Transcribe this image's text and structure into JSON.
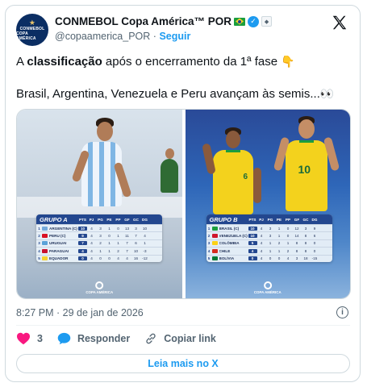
{
  "account": {
    "avatar_line1": "CONMEBOL",
    "avatar_line2": "COPA AMÉRICA",
    "display_name": "CONMEBOL Copa América™ POR",
    "handle": "@copaamerica_POR",
    "separator": "·",
    "follow_label": "Seguir"
  },
  "tweet": {
    "text_part1": "A ",
    "text_bold": "classificação",
    "text_part2": " após o encerramento da 1ª fase ",
    "emoji1": "👇",
    "line2": "Brasil, Argentina, Venezuela e Peru avançam às semis...",
    "emoji2": "👀"
  },
  "media": {
    "group_a": {
      "title": "GRUPO A",
      "columns": [
        "PTS",
        "PJ",
        "PG",
        "PE",
        "PP",
        "GF",
        "GC",
        "DG"
      ],
      "rows": [
        {
          "pos": "1",
          "team": "ARGENTINA (C)",
          "flag": "#75aadb",
          "cells": [
            "10",
            "4",
            "3",
            "1",
            "0",
            "13",
            "3",
            "10"
          ]
        },
        {
          "pos": "2",
          "team": "PERU (C)",
          "flag": "#d91023",
          "cells": [
            "9",
            "4",
            "3",
            "0",
            "1",
            "11",
            "7",
            "4"
          ]
        },
        {
          "pos": "3",
          "team": "URUGUAI",
          "flag": "#5aa2d8",
          "cells": [
            "7",
            "4",
            "2",
            "1",
            "1",
            "7",
            "6",
            "1"
          ]
        },
        {
          "pos": "4",
          "team": "PARAGUAI",
          "flag": "#c8102e",
          "cells": [
            "4",
            "4",
            "1",
            "1",
            "2",
            "7",
            "10",
            "-3"
          ]
        },
        {
          "pos": "5",
          "team": "EQUADOR",
          "flag": "#f5d130",
          "cells": [
            "0",
            "4",
            "0",
            "0",
            "4",
            "4",
            "16",
            "-12"
          ]
        }
      ],
      "logo_line1": "COPA AMÉRICA"
    },
    "group_b": {
      "title": "GRUPO B",
      "columns": [
        "PTS",
        "PJ",
        "PG",
        "PE",
        "PP",
        "GF",
        "GC",
        "DG"
      ],
      "rows": [
        {
          "pos": "1",
          "team": "BRASIL (C)",
          "flag": "#1b9e3e",
          "cells": [
            "10",
            "4",
            "3",
            "1",
            "0",
            "12",
            "3",
            "9"
          ]
        },
        {
          "pos": "2",
          "team": "VENEZUELA (C)",
          "flag": "#cf142b",
          "cells": [
            "10",
            "4",
            "3",
            "1",
            "0",
            "14",
            "8",
            "6"
          ]
        },
        {
          "pos": "3",
          "team": "COLÔMBIA",
          "flag": "#fcd116",
          "cells": [
            "5",
            "4",
            "1",
            "2",
            "1",
            "8",
            "8",
            "0"
          ]
        },
        {
          "pos": "4",
          "team": "CHILE",
          "flag": "#d52b1e",
          "cells": [
            "4",
            "4",
            "1",
            "1",
            "2",
            "8",
            "8",
            "0"
          ]
        },
        {
          "pos": "5",
          "team": "BOLÍVIA",
          "flag": "#007934",
          "cells": [
            "0",
            "4",
            "0",
            "0",
            "4",
            "3",
            "18",
            "-15"
          ]
        }
      ],
      "logo_line1": "COPA AMÉRICA"
    },
    "shirt_numbers": [
      "6",
      "10"
    ]
  },
  "footer": {
    "timestamp": "8:27 PM · 29 de jan de 2026",
    "like_count": "3",
    "reply_label": "Responder",
    "copy_link_label": "Copiar link",
    "read_more_label": "Leia mais no X"
  },
  "colors": {
    "brand_blue": "#1d9bf0",
    "like_red": "#f91880",
    "text_secondary": "#536471",
    "table_blue": "#23478f"
  },
  "icons": {
    "x_logo": "x-logo-icon",
    "verified": "verified-badge-icon",
    "affiliate": "affiliate-badge-icon",
    "heart": "heart-icon",
    "reply": "reply-bubble-icon",
    "link": "link-icon",
    "info": "info-icon"
  }
}
